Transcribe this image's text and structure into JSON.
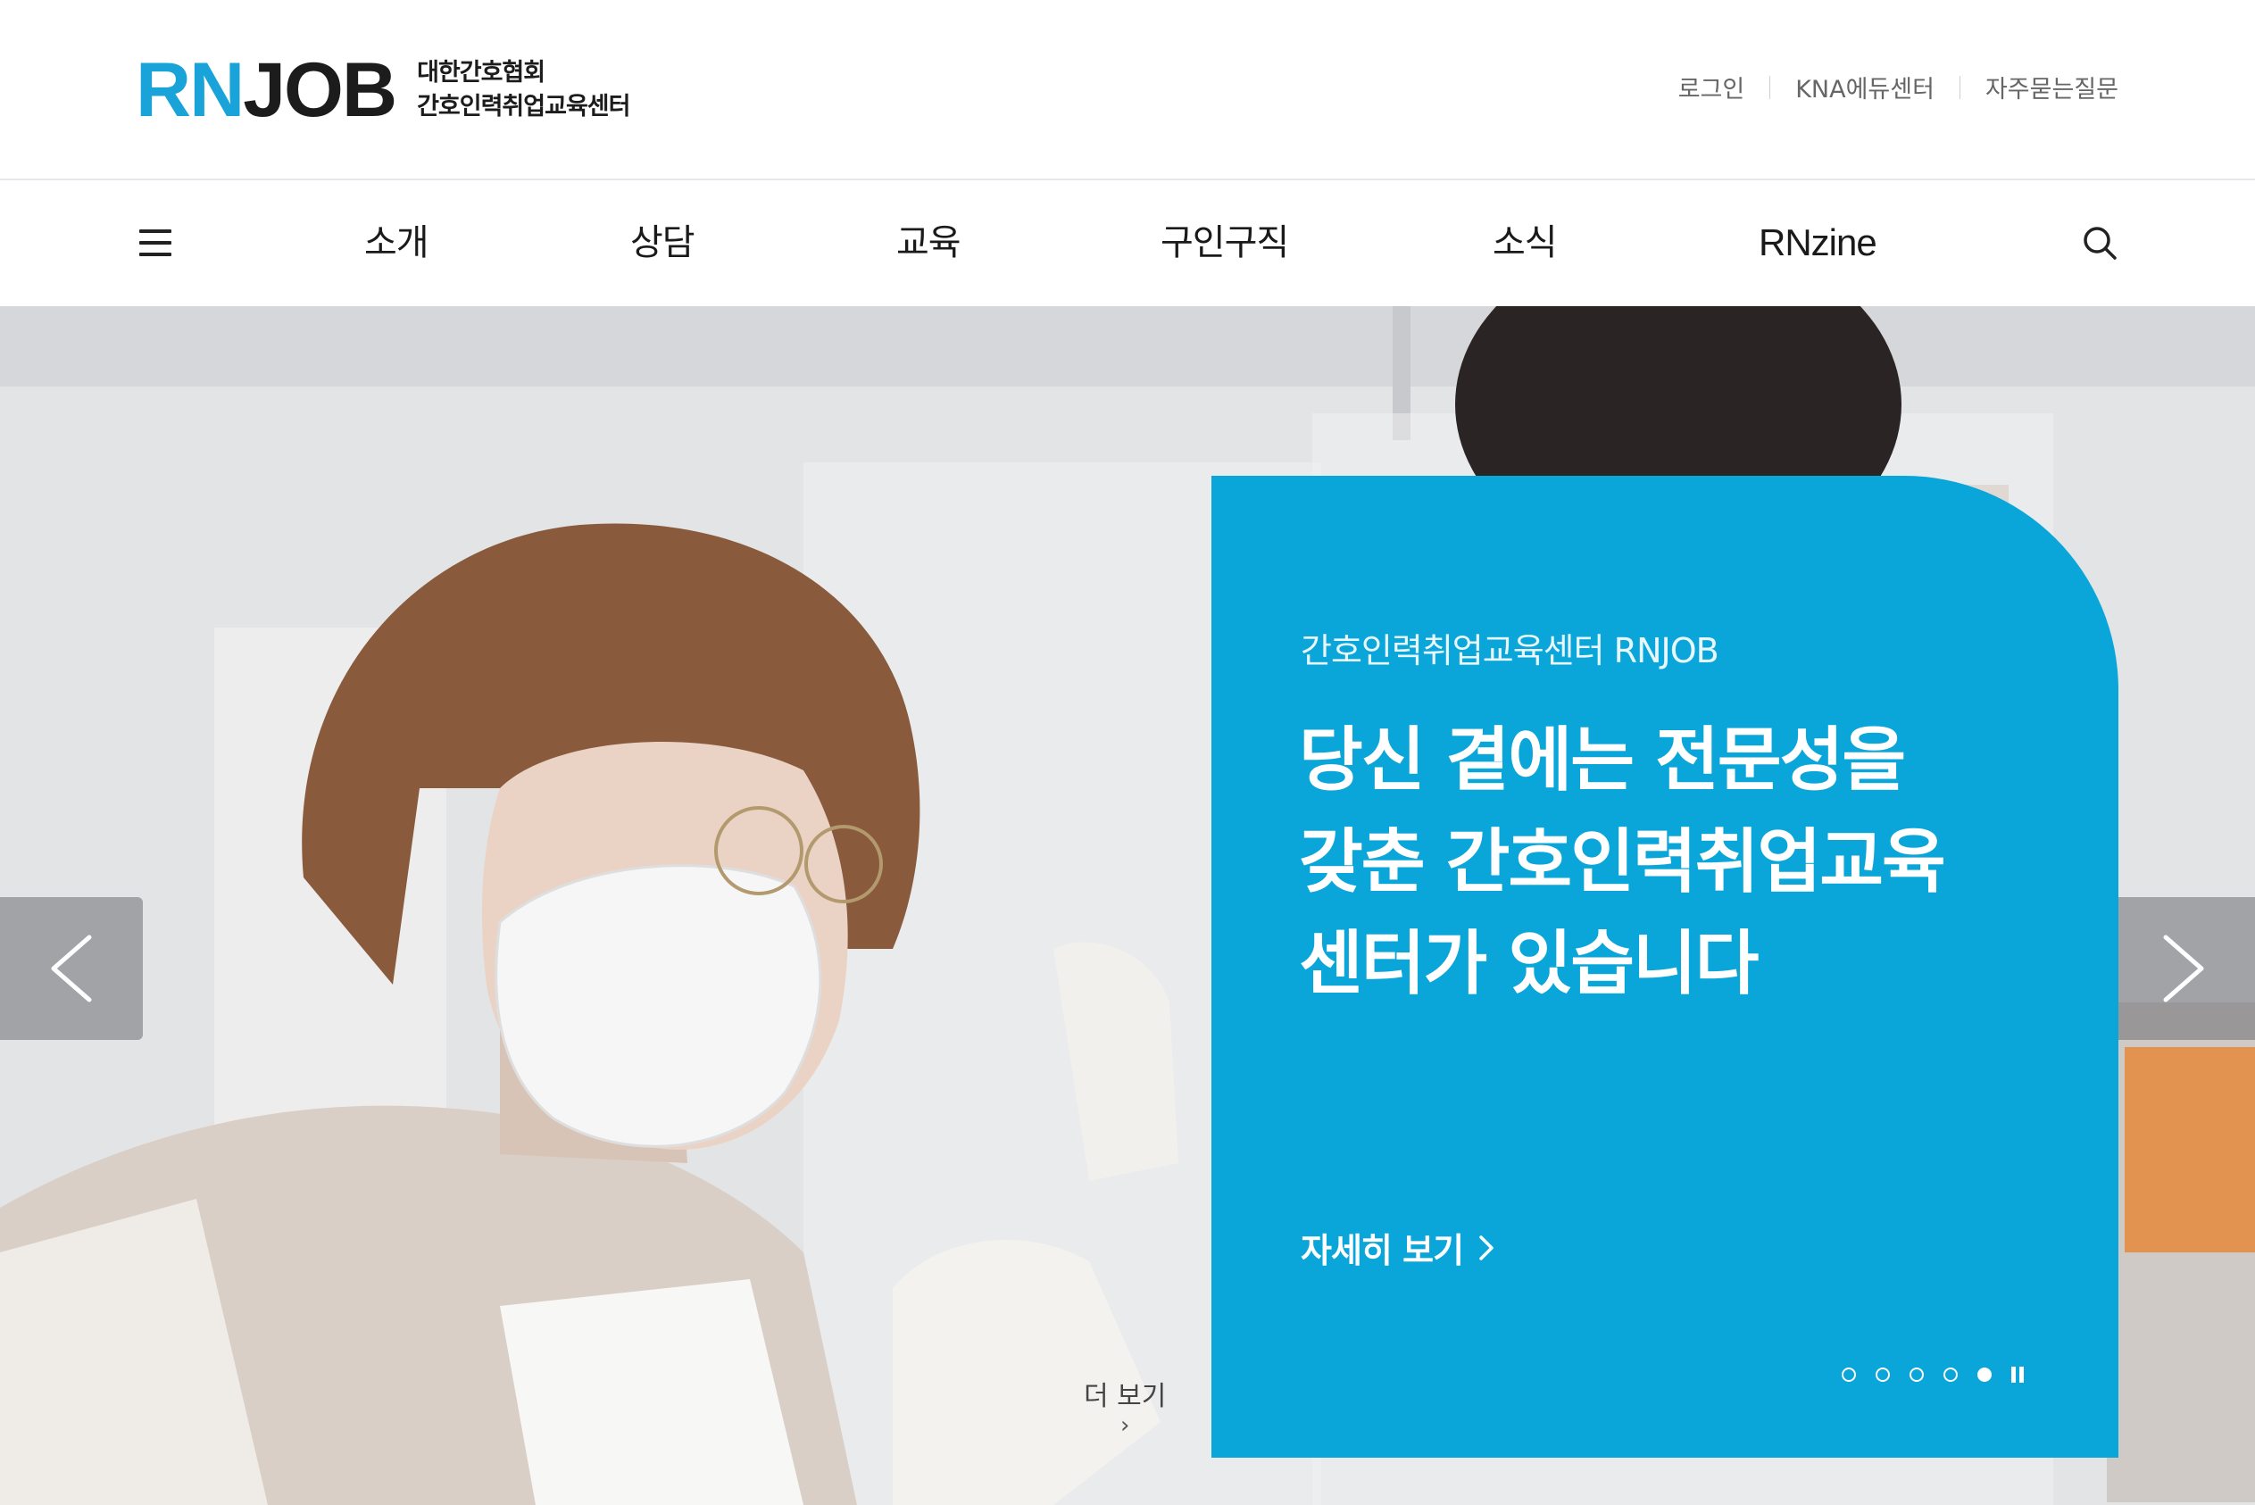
{
  "header": {
    "logo_rn": "RN",
    "logo_job": "JOB",
    "logo_sub_line1": "대한간호협회",
    "logo_sub_line2": "간호인력취업교육센터",
    "util_links": [
      "로그인",
      "KNA에듀센터",
      "자주묻는질문"
    ]
  },
  "gnb": {
    "menu_icon": "hamburger-icon",
    "items": [
      "소개",
      "상담",
      "교육",
      "구인구직",
      "소식",
      "RNzine"
    ],
    "search_icon": "search-icon"
  },
  "hero": {
    "prev_icon": "chevron-left-icon",
    "next_icon": "chevron-right-icon",
    "more_label": "더 보기",
    "more_chevron": "›",
    "card": {
      "kicker": "간호인력취업교육센터 RNJOB",
      "title_lines": [
        "당신 곁에는 전문성을",
        "갖춘 간호인력취업교육",
        "센터가 있습니다"
      ],
      "link_label": "자세히 보기",
      "accent_color": "#0aa6d9"
    },
    "slider": {
      "total_slides": 5,
      "active_slide": 5,
      "pause_icon": "pause-icon"
    }
  }
}
